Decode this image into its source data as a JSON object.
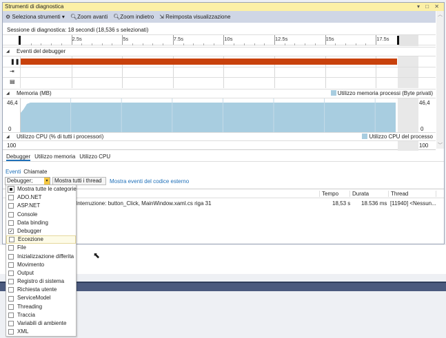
{
  "window": {
    "title": "Strumenti di diagnostica",
    "controls": "▾ □ ✕"
  },
  "toolbar": {
    "select_tools": "Seleziona strumenti",
    "zoom_in": "Zoom avanti",
    "zoom_out": "Zoom indietro",
    "reset_view": "Reimposta visualizzazione"
  },
  "session": {
    "label": "Sessione di diagnostica: 18 secondi (18,536 s selezionati)"
  },
  "ruler": {
    "ticks": [
      "2.5s",
      "5s",
      "7.5s",
      "10s",
      "12.5s",
      "15s",
      "17.5s"
    ]
  },
  "debugger_events": {
    "title": "Eventi del debugger"
  },
  "memory": {
    "title": "Memoria (MB)",
    "legend": "Utilizzo memoria processi (Byte privati)",
    "max": "46,4",
    "min": "0",
    "color": "#a8cde0"
  },
  "cpu": {
    "title": "Utilizzo CPU (% di tutti i processori)",
    "legend": "Utilizzo CPU del processo",
    "max": "100"
  },
  "tabs": [
    "Debugger",
    "Utilizzo memoria",
    "Utilizzo CPU"
  ],
  "subtabs": [
    "Eventi",
    "Chiamate"
  ],
  "filters": {
    "category": "Debugger;",
    "threads": "Mostra tutti i thread",
    "external": "Mostra eventi del codice esterno"
  },
  "table": {
    "columns": [
      "Tempo",
      "Durata",
      "Thread"
    ],
    "rows": [
      {
        "event": "Interruzione: button_Click, MainWindow.xaml.cs riga 31",
        "time": "18,53 s",
        "duration": "18.536 ms",
        "thread": "[11940] <Nessun..."
      }
    ]
  },
  "categories": [
    {
      "label": "Mostra tutte le categorie",
      "state": "partial"
    },
    {
      "label": "ADO.NET",
      "state": "off"
    },
    {
      "label": "ASP.NET",
      "state": "off"
    },
    {
      "label": "Console",
      "state": "off"
    },
    {
      "label": "Data binding",
      "state": "off"
    },
    {
      "label": "Debugger",
      "state": "on"
    },
    {
      "label": "Eccezione",
      "state": "off"
    },
    {
      "label": "File",
      "state": "off"
    },
    {
      "label": "Inizializzazione differita",
      "state": "off"
    },
    {
      "label": "Movimento",
      "state": "off"
    },
    {
      "label": "Output",
      "state": "off"
    },
    {
      "label": "Registro di sistema",
      "state": "off"
    },
    {
      "label": "Richiesta utente",
      "state": "off"
    },
    {
      "label": "ServiceModel",
      "state": "off"
    },
    {
      "label": "Threading",
      "state": "off"
    },
    {
      "label": "Traccia",
      "state": "off"
    },
    {
      "label": "Variabili di ambiente",
      "state": "off"
    },
    {
      "label": "XML",
      "state": "off"
    }
  ]
}
